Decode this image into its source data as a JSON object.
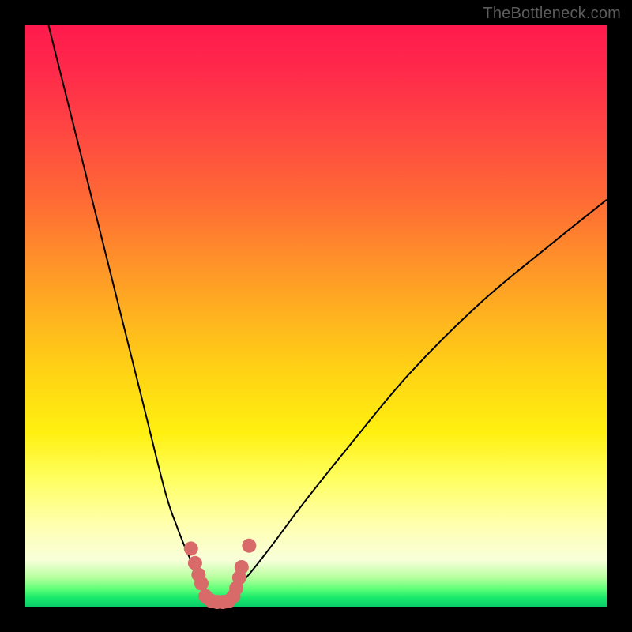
{
  "watermark": "TheBottleneck.com",
  "colors": {
    "frame": "#000000",
    "curve": "#000000",
    "marker": "#d86a6a",
    "gradient_top": "#ff1a4d",
    "gradient_bottom": "#0acc6a"
  },
  "chart_data": {
    "type": "line",
    "title": "",
    "xlabel": "",
    "ylabel": "",
    "xlim": [
      0,
      100
    ],
    "ylim": [
      0,
      100
    ],
    "note": "No axes, ticks, or labels are rendered. Two smooth black curves descend from the top edge to a shared minimum near x≈33 at the very bottom (y≈0), forming a narrow V. Salmon markers cluster around the trough. Values are estimated from pixel position relative to the 736×736 plot area.",
    "series": [
      {
        "name": "left-curve",
        "x": [
          4,
          8,
          12,
          16,
          20,
          24,
          26,
          28,
          30,
          31,
          32,
          33
        ],
        "y": [
          100,
          84,
          68,
          52,
          36,
          20,
          14,
          9,
          5,
          3,
          1.5,
          0.5
        ]
      },
      {
        "name": "right-curve",
        "x": [
          33,
          35,
          38,
          42,
          48,
          56,
          66,
          78,
          90,
          100
        ],
        "y": [
          0.5,
          2,
          5,
          10,
          18,
          28,
          40,
          52,
          62,
          70
        ]
      }
    ],
    "markers": [
      {
        "x": 28.5,
        "y": 10
      },
      {
        "x": 29.2,
        "y": 7.5
      },
      {
        "x": 29.8,
        "y": 5.5
      },
      {
        "x": 30.3,
        "y": 4
      },
      {
        "x": 31.0,
        "y": 1.8
      },
      {
        "x": 32.0,
        "y": 1.0
      },
      {
        "x": 33.0,
        "y": 0.8
      },
      {
        "x": 34.0,
        "y": 0.8
      },
      {
        "x": 35.0,
        "y": 1.0
      },
      {
        "x": 35.8,
        "y": 1.8
      },
      {
        "x": 36.3,
        "y": 3.2
      },
      {
        "x": 36.8,
        "y": 5.0
      },
      {
        "x": 37.2,
        "y": 6.8
      },
      {
        "x": 38.5,
        "y": 10.5
      }
    ]
  }
}
